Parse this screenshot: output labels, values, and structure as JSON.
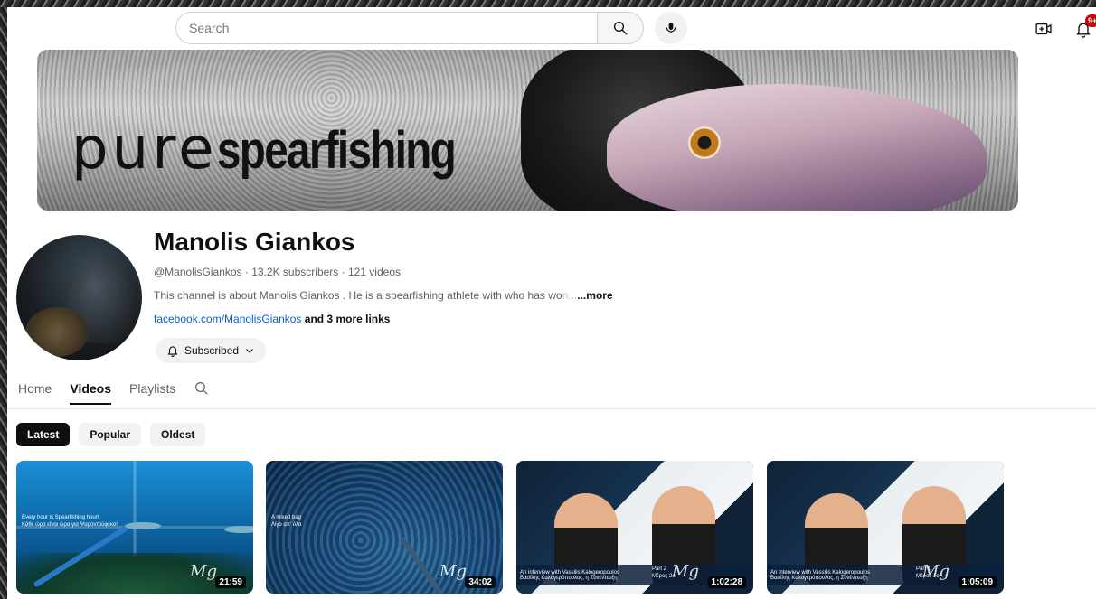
{
  "topbar": {
    "search_placeholder": "Search",
    "notification_count": "9+",
    "icons": {
      "search": "search-icon",
      "mic": "mic-icon",
      "create": "create-video-icon",
      "bell": "bell-icon"
    }
  },
  "banner": {
    "text_pure": "pure",
    "text_spearfishing": "spearfishing"
  },
  "channel": {
    "name": "Manolis Giankos",
    "handle": "@ManolisGiankos",
    "subscribers": "13.2K subscribers",
    "videos_count": "121 videos",
    "separator": " · ",
    "description": "This channel is about Manolis Giankos . He is a spearfishing athlete with who has wo",
    "description_faded": "n...",
    "more_label": "...more",
    "link_text": "facebook.com/ManolisGiankos",
    "more_links": "and 3 more links",
    "subscribed_label": "Subscribed"
  },
  "tabs": [
    {
      "label": "Home",
      "active": false
    },
    {
      "label": "Videos",
      "active": true
    },
    {
      "label": "Playlists",
      "active": false
    }
  ],
  "chips": [
    {
      "label": "Latest",
      "active": true
    },
    {
      "label": "Popular",
      "active": false
    },
    {
      "label": "Oldest",
      "active": false
    }
  ],
  "videos": [
    {
      "duration": "21:59",
      "caption_line1": "Every hour is Spearfishing hour!",
      "caption_line2": "Κάθε ώρα είναι ώρα για Ψαροντούφεκο!"
    },
    {
      "duration": "34:02",
      "caption_line1": "A mixed bag",
      "caption_line2": "Λίγο απ' όλα"
    },
    {
      "duration": "1:02:28",
      "strip_line1": "An interview with Vassilis Kalogeropoulos",
      "strip_line2": "Βασίλης Καλογερόπουλος, η Συνέντευξη",
      "part_line1": "Part 2",
      "part_line2": "Μέρος 2ο"
    },
    {
      "duration": "1:05:09",
      "strip_line1": "An interview with Vassilis Kalogeropoulos",
      "strip_line2": "Βασίλης Καλογερόπουλος, η Συνέντευξη",
      "part_line1": "Part 1",
      "part_line2": "Μέρος 1ο"
    }
  ],
  "colors": {
    "link": "#065fd4",
    "badge": "#cc0000",
    "active_chip": "#0f0f0f"
  }
}
